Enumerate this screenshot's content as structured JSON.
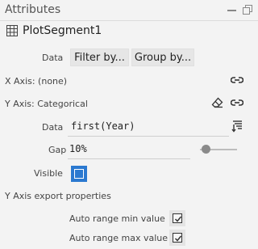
{
  "panel": {
    "title": "Attributes"
  },
  "segment": {
    "name": "PlotSegment1"
  },
  "data_row": {
    "label": "Data",
    "filter_label": "Filter by...",
    "group_label": "Group by..."
  },
  "x_axis": {
    "label": "X Axis: (none)"
  },
  "y_axis": {
    "label": "Y Axis: Categorical",
    "data_label": "Data",
    "data_value": "first(Year)",
    "gap_label": "Gap",
    "gap_value": "10%",
    "gap_fraction": 0.1,
    "visible_label": "Visible",
    "visible_checked": true
  },
  "export": {
    "title": "Y Axis export properties",
    "auto_min_label": "Auto range min value",
    "auto_min_checked": true,
    "auto_max_label": "Auto range max value",
    "auto_max_checked": true
  },
  "colors": {
    "accent": "#2b79d0",
    "background": "#f3f3f3",
    "button": "#e6e6e6"
  },
  "icons": [
    "minimize-icon",
    "restore-icon",
    "table-icon",
    "link-icon",
    "eraser-icon",
    "sort-icon"
  ]
}
